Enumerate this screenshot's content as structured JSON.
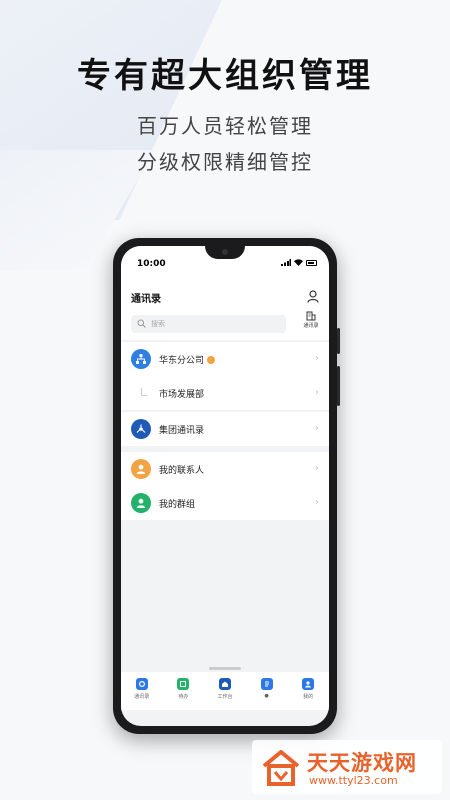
{
  "promo": {
    "headline": "专有超大组织管理",
    "sub1": "百万人员轻松管理",
    "sub2": "分级权限精细管控"
  },
  "status_bar": {
    "time": "10:00"
  },
  "app": {
    "title": "通讯录",
    "search_placeholder": "搜索",
    "scan_label": "通讯录"
  },
  "sections": {
    "company": {
      "label": "华东分公司",
      "sub": "市场发展部"
    },
    "group_directory": {
      "label": "集团通讯录"
    },
    "contacts": {
      "label": "我的联系人"
    },
    "groups": {
      "label": "我的群组"
    }
  },
  "tabs": [
    {
      "label": "通讯录",
      "icon": "contacts-tab-icon"
    },
    {
      "label": "待办",
      "icon": "todo-tab-icon"
    },
    {
      "label": "工作台",
      "icon": "workbench-tab-icon"
    },
    {
      "label": "●",
      "icon": "document-tab-icon"
    },
    {
      "label": "我的",
      "icon": "profile-tab-icon"
    }
  ],
  "watermark": {
    "title": "天天游戏网",
    "url": "www.ttyl23.com"
  },
  "colors": {
    "brand_blue": "#2f7fe0",
    "dark_blue": "#1f5bb5",
    "orange": "#f2a343",
    "green": "#22b26a",
    "tab_blue": "#2e78e6",
    "watermark": "#e8632b"
  }
}
